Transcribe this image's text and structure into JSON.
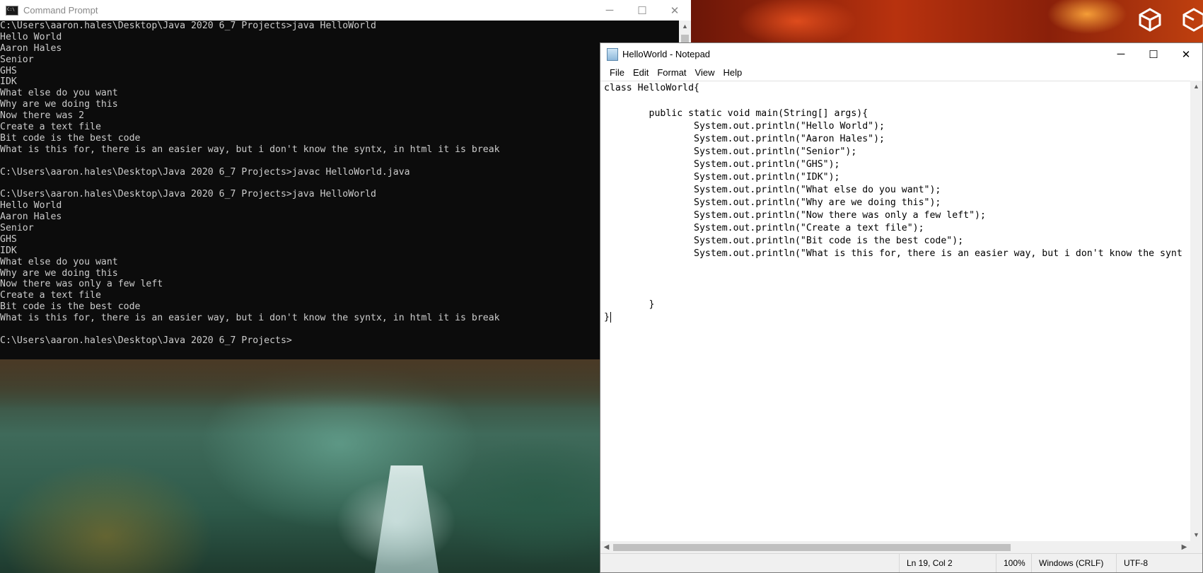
{
  "cmd": {
    "title": "Command Prompt",
    "lines": [
      "C:\\Users\\aaron.hales\\Desktop\\Java 2020 6_7 Projects>java HelloWorld",
      "Hello World",
      "Aaron Hales",
      "Senior",
      "GHS",
      "IDK",
      "What else do you want",
      "Why are we doing this",
      "Now there was 2",
      "Create a text file",
      "Bit code is the best code",
      "What is this for, there is an easier way, but i don't know the syntx, in html it is break",
      "",
      "C:\\Users\\aaron.hales\\Desktop\\Java 2020 6_7 Projects>javac HelloWorld.java",
      "",
      "C:\\Users\\aaron.hales\\Desktop\\Java 2020 6_7 Projects>java HelloWorld",
      "Hello World",
      "Aaron Hales",
      "Senior",
      "GHS",
      "IDK",
      "What else do you want",
      "Why are we doing this",
      "Now there was only a few left",
      "Create a text file",
      "Bit code is the best code",
      "What is this for, there is an easier way, but i don't know the syntx, in html it is break",
      "",
      "C:\\Users\\aaron.hales\\Desktop\\Java 2020 6_7 Projects>"
    ]
  },
  "notepad": {
    "title": "HelloWorld - Notepad",
    "menu": [
      "File",
      "Edit",
      "Format",
      "View",
      "Help"
    ],
    "lines": [
      "class HelloWorld{",
      "",
      "        public static void main(String[] args){",
      "                System.out.println(\"Hello World\");",
      "                System.out.println(\"Aaron Hales\");",
      "                System.out.println(\"Senior\");",
      "                System.out.println(\"GHS\");",
      "                System.out.println(\"IDK\");",
      "                System.out.println(\"What else do you want\");",
      "                System.out.println(\"Why are we doing this\");",
      "                System.out.println(\"Now there was only a few left\");",
      "                System.out.println(\"Create a text file\");",
      "                System.out.println(\"Bit code is the best code\");",
      "                System.out.println(\"What is this for, there is an easier way, but i don't know the synt",
      "",
      "",
      "",
      "        }",
      "}"
    ],
    "status": {
      "position": "Ln 19, Col 2",
      "zoom": "100%",
      "line_ending": "Windows (CRLF)",
      "encoding": "UTF-8"
    }
  },
  "icons": {
    "minimize": "minimize-icon",
    "maximize": "maximize-icon",
    "close": "close-icon"
  },
  "colors": {
    "cmd_background": "#0c0c0c",
    "cmd_text": "#cccccc",
    "notepad_background": "#ffffff",
    "statusbar": "#f0f0f0"
  }
}
